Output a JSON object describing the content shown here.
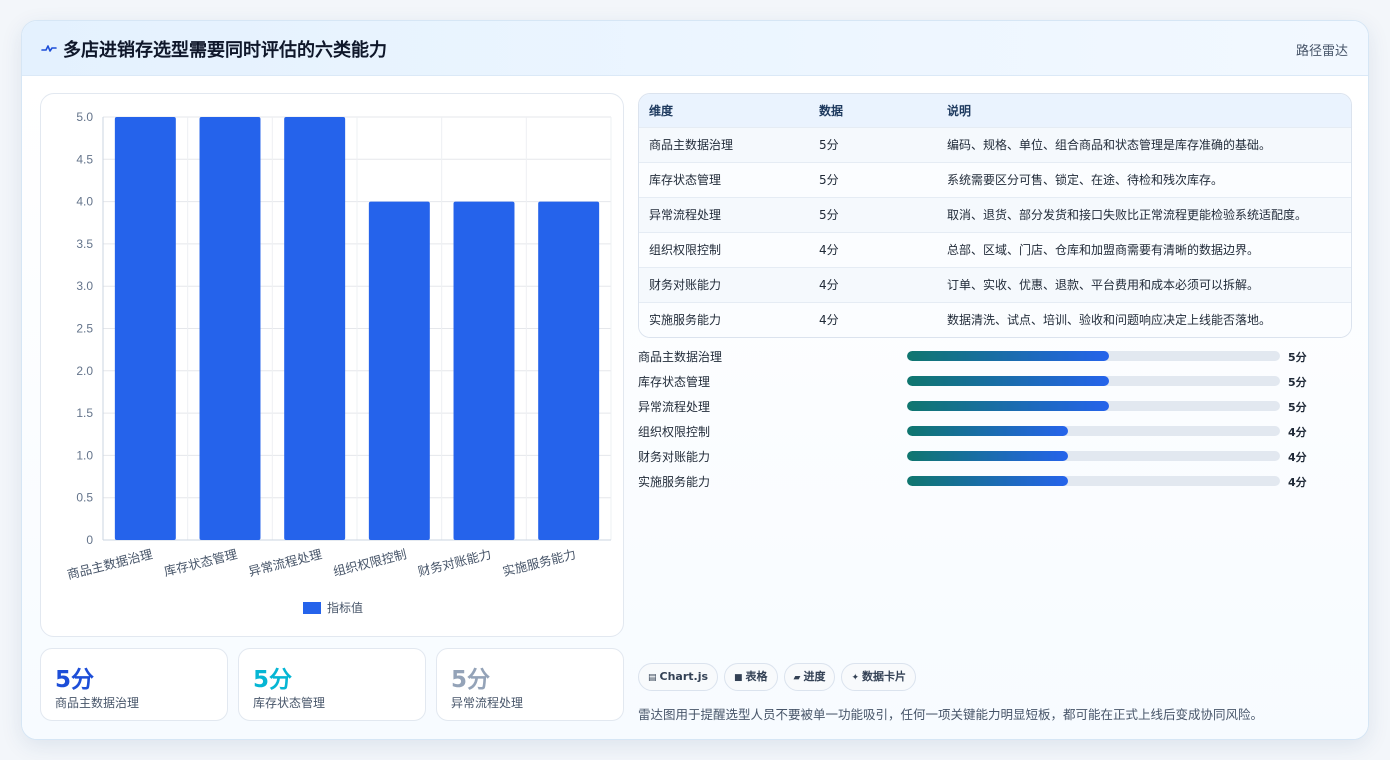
{
  "header": {
    "title": "多店进销存选型需要同时评估的六类能力",
    "tag": "路径雷达"
  },
  "colors": {
    "bar": "#2563eb",
    "kpi_1": "#1d4ed8",
    "kpi_2": "#06b6d4",
    "kpi_3": "#94a3b8",
    "progress_start": "#0f766e",
    "progress_end": "#2563eb"
  },
  "chart_data": {
    "type": "bar",
    "categories": [
      "商品主数据治理",
      "库存状态管理",
      "异常流程处理",
      "组织权限控制",
      "财务对账能力",
      "实施服务能力"
    ],
    "series": [
      {
        "name": "指标值",
        "values": [
          5,
          5,
          5,
          4,
          4,
          4
        ]
      }
    ],
    "y_ticks": [
      "0",
      "0.5",
      "1.0",
      "1.5",
      "2.0",
      "2.5",
      "3.0",
      "3.5",
      "4.0",
      "4.5",
      "5.0"
    ],
    "ylim": [
      0,
      5
    ],
    "grid": true,
    "legend_position": "bottom"
  },
  "table": {
    "headers": [
      "维度",
      "数据",
      "说明"
    ],
    "rows": [
      [
        "商品主数据治理",
        "5分",
        "编码、规格、单位、组合商品和状态管理是库存准确的基础。"
      ],
      [
        "库存状态管理",
        "5分",
        "系统需要区分可售、锁定、在途、待检和残次库存。"
      ],
      [
        "异常流程处理",
        "5分",
        "取消、退货、部分发货和接口失败比正常流程更能检验系统适配度。"
      ],
      [
        "组织权限控制",
        "4分",
        "总部、区域、门店、仓库和加盟商需要有清晰的数据边界。"
      ],
      [
        "财务对账能力",
        "4分",
        "订单、实收、优惠、退款、平台费用和成本必须可以拆解。"
      ],
      [
        "实施服务能力",
        "4分",
        "数据清洗、试点、培训、验收和问题响应决定上线能否落地。"
      ]
    ]
  },
  "progress": {
    "max": 9.25,
    "items": [
      {
        "label": "商品主数据治理",
        "value": 5,
        "value_text": "5分"
      },
      {
        "label": "库存状态管理",
        "value": 5,
        "value_text": "5分"
      },
      {
        "label": "异常流程处理",
        "value": 5,
        "value_text": "5分"
      },
      {
        "label": "组织权限控制",
        "value": 4,
        "value_text": "4分"
      },
      {
        "label": "财务对账能力",
        "value": 4,
        "value_text": "4分"
      },
      {
        "label": "实施服务能力",
        "value": 4,
        "value_text": "4分"
      }
    ]
  },
  "kpis": [
    {
      "value": "5分",
      "label": "商品主数据治理"
    },
    {
      "value": "5分",
      "label": "库存状态管理"
    },
    {
      "value": "5分",
      "label": "异常流程处理"
    }
  ],
  "chips": [
    {
      "icon": "chart-icon",
      "label": "Chart.js"
    },
    {
      "icon": "table-icon",
      "label": "表格"
    },
    {
      "icon": "progress-icon",
      "label": "进度"
    },
    {
      "icon": "sparkle-icon",
      "label": "数据卡片"
    }
  ],
  "note": "雷达图用于提醒选型人员不要被单一功能吸引，任何一项关键能力明显短板，都可能在正式上线后变成协同风险。"
}
